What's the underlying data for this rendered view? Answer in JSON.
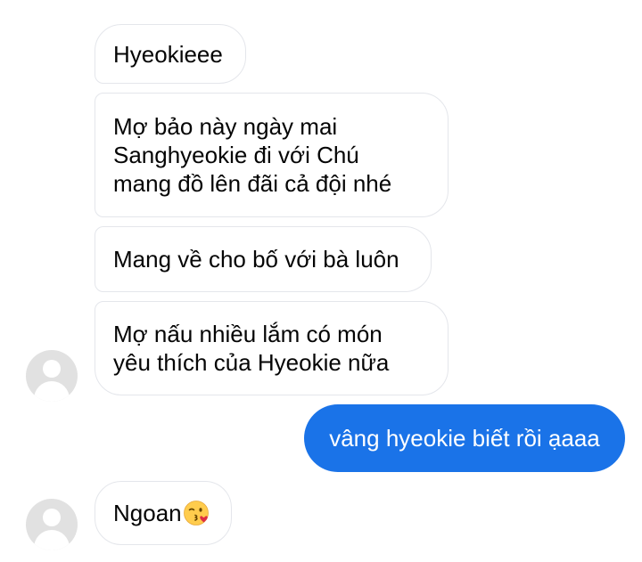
{
  "messages": {
    "m1": "Hyeokieee",
    "m2": {
      "line1": "Mợ bảo này ngày mai",
      "line2": "Sanghyeokie đi với Chú",
      "line3": "mang đồ lên đãi cả đội nhé"
    },
    "m3": "Mang về cho bố với bà luôn",
    "m4": {
      "line1": "Mợ nấu nhiều lắm có món",
      "line2": "yêu thích của Hyeokie nữa"
    },
    "sent": "vâng hyeokie biết rồi ạaaa",
    "m5": "Ngoan",
    "m5_emoji": "face-blowing-a-kiss-icon"
  },
  "colors": {
    "sent_bubble": "#1a73e8",
    "received_border": "#e4e6eb",
    "avatar_bg": "#e1e1e1"
  }
}
